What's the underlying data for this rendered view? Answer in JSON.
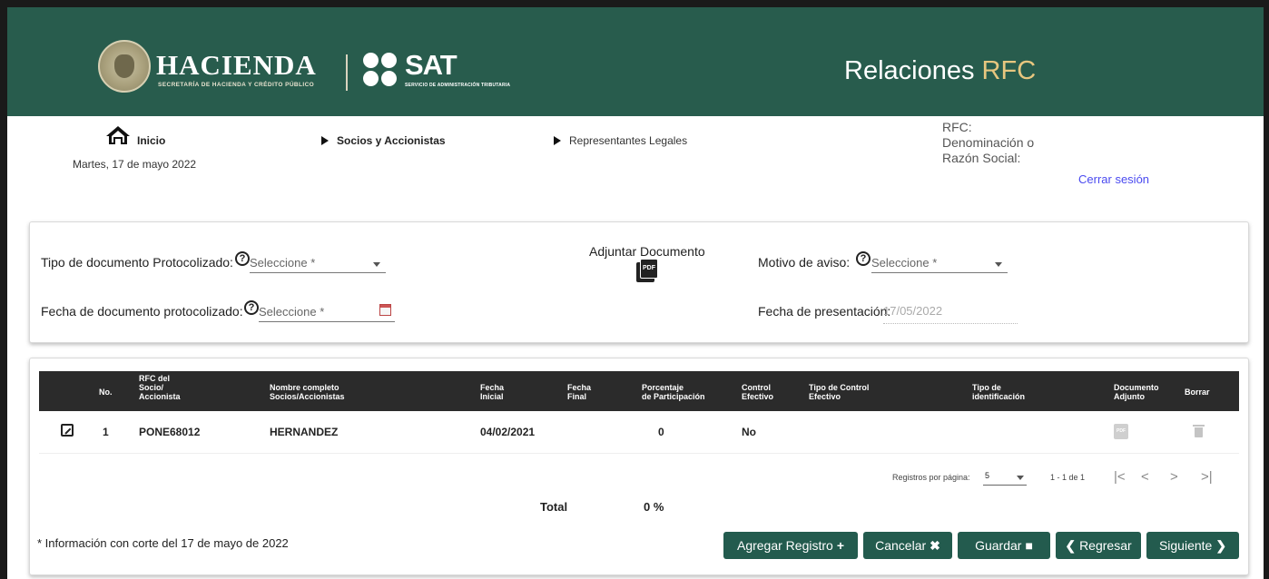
{
  "header": {
    "brand_title": "HACIENDA",
    "brand_subtitle": "SECRETARÍA DE HACIENDA Y CRÉDITO PÚBLICO",
    "sat_title": "SAT",
    "sat_subtitle": "SERVICIO DE ADMINISTRACIÓN TRIBUTARIA",
    "app_title_main": "Relaciones",
    "app_title_accent": "RFC",
    "colors": {
      "primary": "#285c4d",
      "accent": "#e7c67f"
    }
  },
  "nav": {
    "home_label": "Inicio",
    "date": "Martes, 17 de mayo 2022",
    "socios_label": "Socios y Accionistas",
    "representantes_label": "Representantes Legales",
    "rfc_label": "RFC:",
    "denominacion_label": "Denominación o",
    "razon_label": "Razón Social:",
    "logout_label": "Cerrar sesión"
  },
  "form": {
    "tipo_doc_label": "Tipo de documento Protocolizado:",
    "tipo_doc_placeholder": "Seleccione *",
    "fecha_doc_label": "Fecha de documento protocolizado:",
    "fecha_doc_placeholder": "Seleccione *",
    "adjuntar_label": "Adjuntar Documento",
    "pdf_text": "PDF",
    "motivo_label": "Motivo de aviso:",
    "motivo_placeholder": "Seleccione *",
    "fecha_pres_label": "Fecha de presentación:",
    "fecha_pres_value": "17/05/2022"
  },
  "table": {
    "headers": {
      "no": "No.",
      "rfc_1": "RFC del",
      "rfc_2": "Socio/",
      "rfc_3": "Accionista",
      "nombre_1": "Nombre completo",
      "nombre_2": "Socios/Accionistas",
      "fi_1": "Fecha",
      "fi_2": "Inicial",
      "ff_1": "Fecha",
      "ff_2": "Final",
      "porc_1": "Porcentaje",
      "porc_2": "de Participación",
      "ctrl_1": "Control",
      "ctrl_2": "Efectivo",
      "tipo_ctrl_1": "Tipo de Control",
      "tipo_ctrl_2": "Efectivo",
      "tipo_id_1": "Tipo de",
      "tipo_id_2": "identificación",
      "doc_1": "Documento",
      "doc_2": "Adjunto",
      "borrar": "Borrar"
    },
    "rows": [
      {
        "no": "1",
        "rfc": "PONE68012",
        "nombre": "HERNANDEZ",
        "fecha_inicial": "04/02/2021",
        "fecha_final": "",
        "porcentaje": "0",
        "control": "No"
      }
    ],
    "pagination": {
      "per_page_label": "Registros por página:",
      "per_page_value": "5",
      "range": "1 - 1 de 1",
      "first": "|<",
      "prev": "<",
      "next": ">",
      "last": ">|"
    },
    "total_label": "Total",
    "total_value": "0 %",
    "note": "* Información con corte del 17 de mayo de 2022"
  },
  "actions": {
    "agregar": "Agregar Registro",
    "cancelar": "Cancelar",
    "guardar": "Guardar",
    "regresar": "Regresar",
    "siguiente": "Siguiente"
  }
}
